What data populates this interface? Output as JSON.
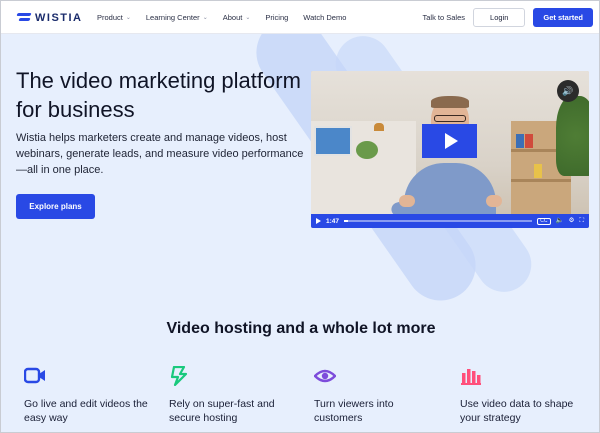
{
  "brand": {
    "name": "WISTIA",
    "primary": "#2949e5"
  },
  "nav": {
    "links": [
      {
        "label": "Product",
        "has_dropdown": true
      },
      {
        "label": "Learning Center",
        "has_dropdown": true
      },
      {
        "label": "About",
        "has_dropdown": true
      },
      {
        "label": "Pricing",
        "has_dropdown": false
      },
      {
        "label": "Watch Demo",
        "has_dropdown": false
      }
    ],
    "talk_to_sales": "Talk to Sales",
    "login": "Login",
    "get_started": "Get started"
  },
  "hero": {
    "title": "The video marketing platform for business",
    "description": "Wistia helps marketers create and manage videos, host webinars, generate leads, and measure video performance—all in one place.",
    "cta": "Explore plans"
  },
  "video": {
    "time": "1:47",
    "progress_fraction": 0.02,
    "icons": [
      "volume-icon",
      "play-icon",
      "captions-icon",
      "volume-icon",
      "settings-icon",
      "fullscreen-icon"
    ],
    "cc_label": "CC"
  },
  "section": {
    "title": "Video hosting and a whole lot more",
    "features": [
      {
        "icon": "camera-icon",
        "color": "#2949e5",
        "text": "Go live and edit videos the easy way"
      },
      {
        "icon": "lightning-icon",
        "color": "#19c97d",
        "text": "Rely on super-fast and secure hosting"
      },
      {
        "icon": "eye-icon",
        "color": "#7d4cdb",
        "text": "Turn viewers into customers"
      },
      {
        "icon": "bar-chart-icon",
        "color": "#ff4f7b",
        "text": "Use video data to shape your strategy"
      }
    ]
  }
}
